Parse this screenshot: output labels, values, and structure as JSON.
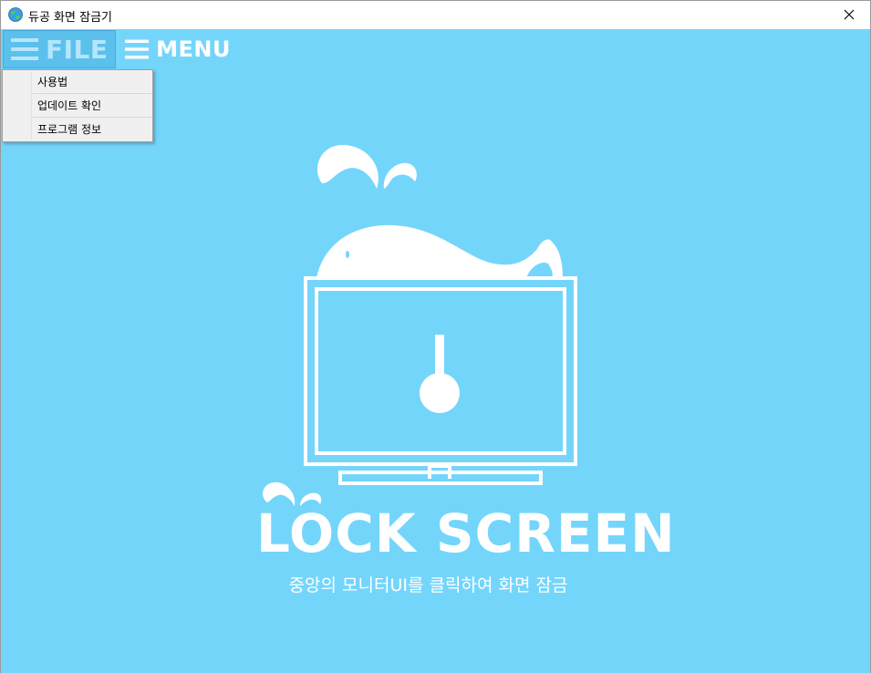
{
  "window": {
    "title": "듀공 화면 잠금기",
    "icon": "globe-icon",
    "close": "close-icon"
  },
  "colors": {
    "background": "#74d5fb",
    "file_menu_highlight": "#5cc0ec",
    "white": "#ffffff"
  },
  "menubar": {
    "file_label": "FILE",
    "menu_label": "MENU"
  },
  "dropdown": {
    "items": [
      {
        "label": "사용법"
      },
      {
        "label": "업데이트 확인"
      },
      {
        "label": "프로그램 정보"
      }
    ]
  },
  "main": {
    "title": "LOCK SCREEN",
    "subtitle": "중앙의 모니터UI를 클릭하여 화면 잠금"
  }
}
